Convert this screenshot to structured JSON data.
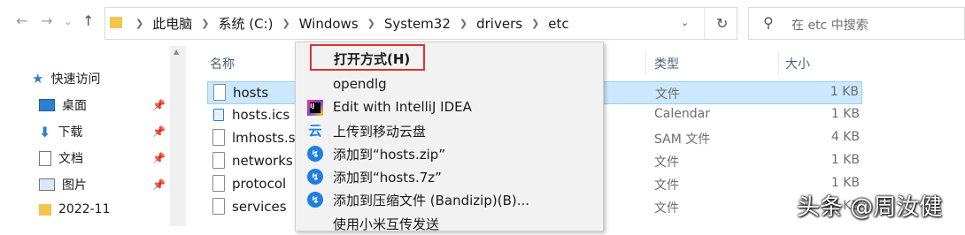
{
  "address_bar": {
    "segments": [
      "此电脑",
      "系统 (C:)",
      "Windows",
      "System32",
      "drivers",
      "etc"
    ]
  },
  "search": {
    "placeholder": "在 etc 中搜索"
  },
  "sidebar": {
    "items": [
      {
        "label": "快速访问",
        "icon": "star-icon"
      },
      {
        "label": "桌面",
        "icon": "desktop-icon"
      },
      {
        "label": "下载",
        "icon": "download-icon"
      },
      {
        "label": "文档",
        "icon": "document-icon"
      },
      {
        "label": "图片",
        "icon": "picture-icon"
      },
      {
        "label": "2022-11",
        "icon": "folder-icon"
      }
    ]
  },
  "columns": {
    "name": "名称",
    "type": "类型",
    "size": "大小"
  },
  "files": [
    {
      "name": "hosts",
      "type": "文件",
      "size": "1 KB",
      "selected": true
    },
    {
      "name": "hosts.ics",
      "type": "Calendar",
      "size": "1 KB"
    },
    {
      "name": "lmhosts.sa",
      "type": "SAM 文件",
      "size": "4 KB"
    },
    {
      "name": "networks",
      "type": "文件",
      "size": "1 KB"
    },
    {
      "name": "protocol",
      "type": "文件",
      "size": "1 KB"
    },
    {
      "name": "services",
      "type": "文件",
      "size": "18 KB"
    }
  ],
  "context_menu": {
    "open_with": "打开方式(H)",
    "items": [
      {
        "label": "opendlg",
        "icon": "none"
      },
      {
        "label": "Edit with IntelliJ IDEA",
        "icon": "intellij-icon"
      },
      {
        "label": "上传到移动云盘",
        "icon": "cloud-icon"
      },
      {
        "label": "添加到“hosts.zip”",
        "icon": "bandizip-icon"
      },
      {
        "label": "添加到“hosts.7z”",
        "icon": "bandizip-icon"
      },
      {
        "label": "添加到压缩文件 (Bandizip)(B)...",
        "icon": "bandizip-icon"
      },
      {
        "label": "使用小米互传发送",
        "icon": "none"
      }
    ]
  },
  "watermark": "头条 @周汝健",
  "colors": {
    "selection": "#cce8ff",
    "highlight_border": "#e0312a",
    "accent": "#1e7fe0"
  }
}
